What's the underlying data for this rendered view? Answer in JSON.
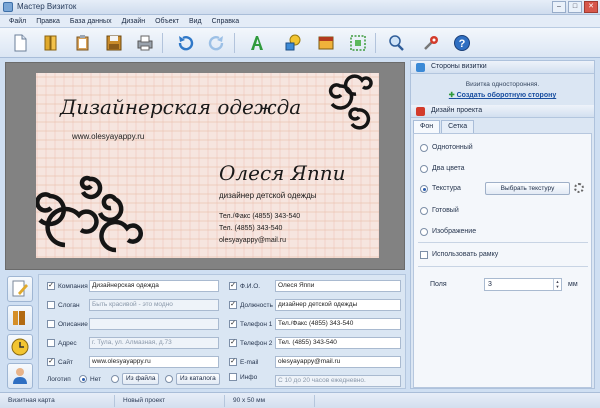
{
  "window": {
    "title": "Мастер Визиток",
    "buttons": [
      "–",
      "□",
      "✕"
    ]
  },
  "menu": [
    "Файл",
    "Правка",
    "База данных",
    "Дизайн",
    "Объект",
    "Вид",
    "Справка"
  ],
  "toolbar": {
    "icons": [
      "new-file-icon",
      "open-book-icon",
      "clipboard-icon",
      "save-icon",
      "print-icon",
      "undo-icon",
      "redo-icon",
      "text-tool-icon",
      "shapes-tool-icon",
      "image-tool-icon",
      "qr-tool-icon",
      "zoom-icon",
      "settings-icon",
      "help-icon"
    ]
  },
  "card": {
    "company": "Дизайнерская одежда",
    "site": "www.olesyayappy.ru",
    "name": "Олеся Яппи",
    "job": "дизайнер детской одежды",
    "line1": "Тел./Факс (4855) 343-540",
    "line2": "Тел. (4855) 343-540",
    "line3": "olesyayappy@mail.ru"
  },
  "form": {
    "company_label": "Компания",
    "company_value": "Дизайнерская одежда",
    "slogan_label": "Слоган",
    "slogan_value": "Быть красивой - это модно",
    "desc_label": "Описание",
    "desc_value": "",
    "address_label": "Адрес",
    "address_value": "г. Тула, ул. Алмазная, д.73",
    "site_label": "Сайт",
    "site_value": "www.olesyayappy.ru",
    "logo_label": "Логотип",
    "logo_no": "Нет",
    "logo_file": "Из файла",
    "logo_catalog": "Из каталога",
    "fio_label": "Ф.И.О.",
    "fio_value": "Олеся Яппи",
    "post_label": "Должность",
    "post_value": "дизайнер детской одежды",
    "phone1_label": "Телефон 1",
    "phone1_value": "Тел./Факс (4855) 343-540",
    "phone2_label": "Телефон 2",
    "phone2_value": "Тел. (4855) 343-540",
    "email_label": "E-mail",
    "email_value": "olesyayappy@mail.ru",
    "info_label": "Инфо",
    "info_value": "С 10 до 20 часов ежедневно."
  },
  "panel": {
    "sides_header": "Стороны визитки",
    "sides_text": "Визитка односторонняя.",
    "sides_link": "Создать оборотную сторону",
    "design_header": "Дизайн проекта",
    "tabs": [
      "Фон",
      "Сетка"
    ],
    "opt_plain": "Однотонный",
    "opt_two": "Два цвета",
    "opt_texture": "Текстура",
    "texture_button": "Выбрать текстуру",
    "opt_ready": "Готовый",
    "opt_image": "Изображение",
    "use_frame": "Использовать рамку",
    "margins_label": "Поля",
    "margins_value": "3",
    "margins_unit": "мм"
  },
  "status": {
    "type": "Визитная карта",
    "project": "Новый проект",
    "size": "90 x 50 мм"
  },
  "colors": {
    "accent": "#2a5db0",
    "card_bg": "#f6e5df",
    "canvas": "#828282",
    "link": "#1a4fa0"
  }
}
